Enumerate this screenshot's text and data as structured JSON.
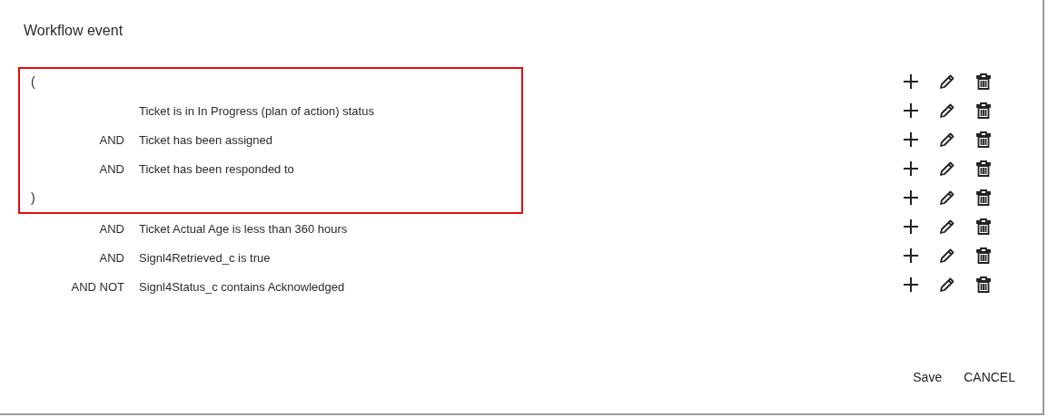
{
  "dialog": {
    "title": "Workflow event",
    "conditions": [
      {
        "kind": "bracket",
        "text": "(",
        "highlighted": true
      },
      {
        "kind": "condition",
        "text": "Ticket is in In Progress (plan of action) status",
        "highlighted": true
      },
      {
        "kind": "condition",
        "operator": "AND",
        "text": "Ticket has been assigned",
        "highlighted": true
      },
      {
        "kind": "condition",
        "operator": "AND",
        "text": "Ticket has been responded to",
        "highlighted": true
      },
      {
        "kind": "bracket",
        "text": ")",
        "highlighted": true
      },
      {
        "kind": "condition",
        "operator": "AND",
        "text": "Ticket Actual Age is less than 360 hours",
        "highlighted": false
      },
      {
        "kind": "condition",
        "operator": "AND",
        "text": "Signl4Retrieved_c is true",
        "highlighted": false
      },
      {
        "kind": "condition",
        "operator": "AND NOT",
        "text": "Signl4Status_c contains Acknowledged",
        "highlighted": false
      }
    ],
    "buttons": [
      "Save",
      "CANCEL"
    ]
  }
}
